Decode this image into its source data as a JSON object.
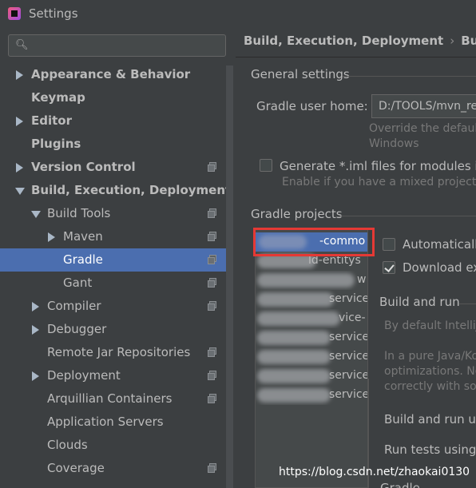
{
  "window": {
    "title": "Settings"
  },
  "search": {
    "placeholder": "",
    "value": ""
  },
  "sidebar": {
    "items": [
      {
        "label": "Appearance & Behavior",
        "bold": true
      },
      {
        "label": "Keymap",
        "bold": true
      },
      {
        "label": "Editor",
        "bold": true
      },
      {
        "label": "Plugins",
        "bold": true
      },
      {
        "label": "Version Control",
        "bold": true
      },
      {
        "label": "Build, Execution, Deployment",
        "bold": true
      },
      {
        "label": "Build Tools"
      },
      {
        "label": "Maven"
      },
      {
        "label": "Gradle",
        "selected": true
      },
      {
        "label": "Gant"
      },
      {
        "label": "Compiler"
      },
      {
        "label": "Debugger"
      },
      {
        "label": "Remote Jar Repositories"
      },
      {
        "label": "Deployment"
      },
      {
        "label": "Arquillian Containers"
      },
      {
        "label": "Application Servers"
      },
      {
        "label": "Clouds"
      },
      {
        "label": "Coverage"
      }
    ]
  },
  "main": {
    "breadcrumb": [
      "Build, Execution, Deployment",
      "Build Too"
    ],
    "breadcrumb_sep": "›",
    "general_settings": "General settings",
    "gradle_user_home_label": "Gradle user home:",
    "gradle_user_home_value": "D:/TOOLS/mvn_rep",
    "override_hint": [
      "Override the default",
      "Windows"
    ],
    "generate_iml_label": "Generate *.iml files for modules impo",
    "generate_iml_hint": "Enable if you have a mixed project w",
    "gradle_projects": "Gradle projects",
    "projects": [
      "-commo",
      "ld-entitys",
      "w",
      "service-",
      "vice-",
      "service-",
      "service-",
      "service-",
      "service-"
    ],
    "auto_label": "Automatically",
    "download_label": "Download ext",
    "build_and_run": "Build and run",
    "by_default": "By default IntelliJ",
    "pure_java": [
      "In a pure Java/Ko",
      "optimizations. No",
      "correctly with so"
    ],
    "build_run_using": "Build and run usi",
    "run_tests_using": "Run tests using:",
    "gradle_cut": "Gradle"
  },
  "watermark": "https://blog.csdn.net/zhaokai0130",
  "colors": {
    "background": "#3c3f41",
    "selection": "#4b6eaf",
    "annotation": "#e53935"
  }
}
